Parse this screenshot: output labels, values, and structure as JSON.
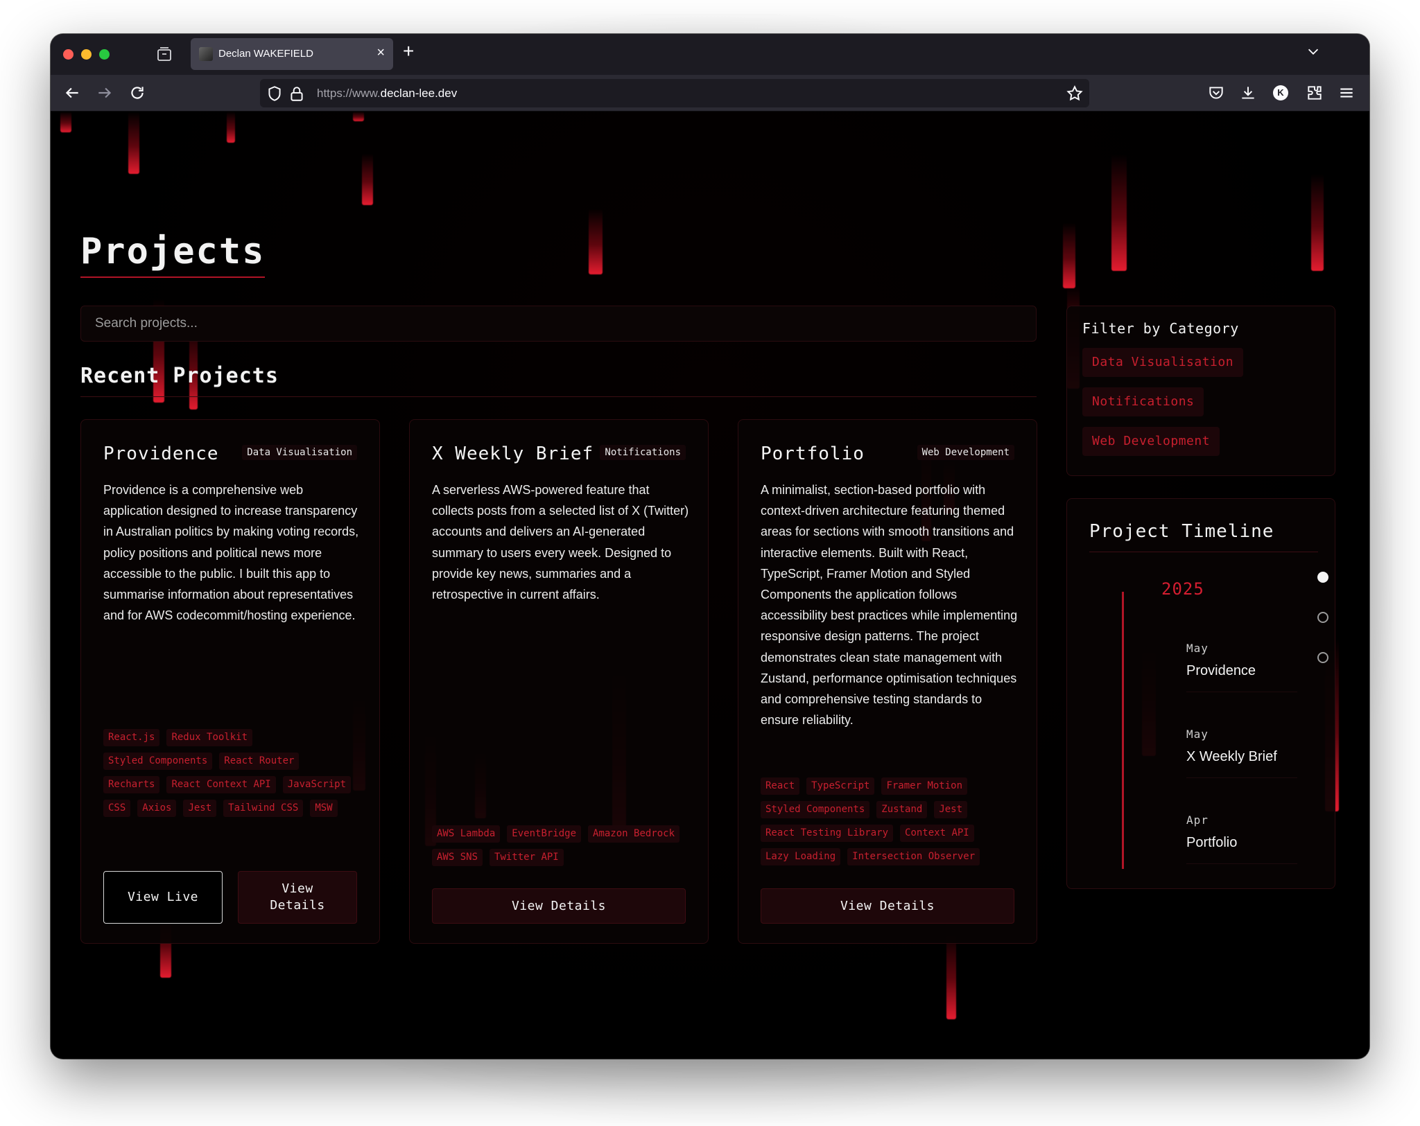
{
  "browser": {
    "tab_title": "Declan WAKEFIELD",
    "tab_close": "×",
    "new_tab": "+",
    "url_prefix": "https://www.",
    "url_domain": "declan-lee.dev",
    "account_initial": "K",
    "icons": [
      "tab-manager-icon",
      "back-icon",
      "forward-icon",
      "reload-icon",
      "shield-icon",
      "lock-icon",
      "bookmark-star-icon",
      "pocket-icon",
      "download-icon",
      "extensions-icon",
      "menu-icon",
      "tab-list-chevron-icon"
    ]
  },
  "page": {
    "title": "Projects",
    "search_placeholder": "Search projects...",
    "recent_title": "Recent Projects"
  },
  "projects": [
    {
      "name": "Providence",
      "category": "Data Visualisation",
      "description": "Providence is a comprehensive web application designed to increase transparency in Australian politics by making voting records, policy positions and political news more accessible to the public. I built this app to summarise information about representatives and for AWS codecommit/hosting experience.",
      "tags": [
        "React.js",
        "Redux Toolkit",
        "Styled Components",
        "React Router",
        "Recharts",
        "React Context API",
        "JavaScript",
        "CSS",
        "Axios",
        "Jest",
        "Tailwind CSS",
        "MSW"
      ],
      "live_label": "View Live",
      "details_label": "View Details"
    },
    {
      "name": "X Weekly Brief",
      "category": "Notifications",
      "description": "A serverless AWS-powered feature that collects posts from a selected list of X (Twitter) accounts and delivers an AI-generated summary to users every week. Designed to provide key news, summaries and a retrospective in current affairs.",
      "tags": [
        "AWS Lambda",
        "EventBridge",
        "Amazon Bedrock",
        "AWS SNS",
        "Twitter API"
      ],
      "details_label": "View Details"
    },
    {
      "name": "Portfolio",
      "category": "Web Development",
      "description": "A minimalist, section-based portfolio with context-driven architecture featuring themed areas for sections with smooth transitions and interactive elements. Built with React, TypeScript, Framer Motion and Styled Components the application follows accessibility best practices while implementing responsive design patterns. The project demonstrates clean state management with Zustand, performance optimisation techniques and comprehensive testing standards to ensure reliability.",
      "tags": [
        "React",
        "TypeScript",
        "Framer Motion",
        "Styled Components",
        "Zustand",
        "Jest",
        "React Testing Library",
        "Context API",
        "Lazy Loading",
        "Intersection Observer"
      ],
      "details_label": "View Details"
    }
  ],
  "filter": {
    "title": "Filter by Category",
    "categories": [
      "Data Visualisation",
      "Notifications",
      "Web Development"
    ]
  },
  "timeline": {
    "title": "Project Timeline",
    "year": "2025",
    "entries": [
      {
        "month": "May",
        "name": "Providence"
      },
      {
        "month": "May",
        "name": "X Weekly Brief"
      },
      {
        "month": "Apr",
        "name": "Portfolio"
      }
    ],
    "active_dot": 0
  },
  "colors": {
    "accent": "#c8202f",
    "background": "#000000",
    "browser_chrome": "#2b2a33"
  }
}
